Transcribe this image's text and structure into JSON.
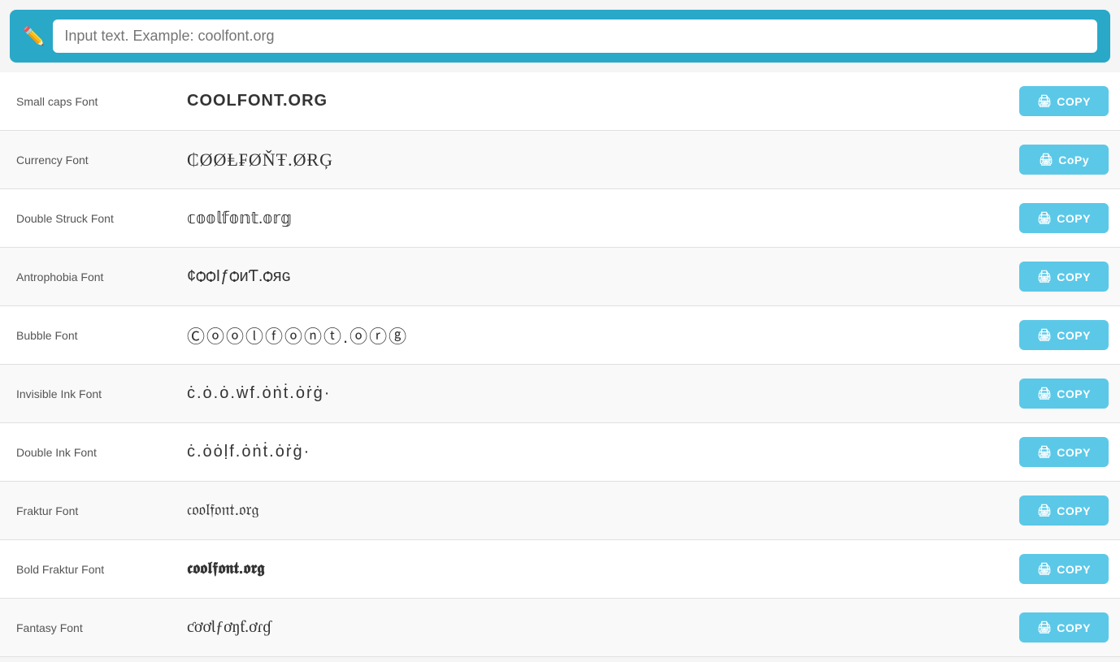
{
  "header": {
    "placeholder": "Input text. Example: coolfont.org",
    "pencil_icon": "✏️"
  },
  "fonts": [
    {
      "label": "Small caps Font",
      "preview": "COOLFONT.ORG",
      "style_class": "small-caps",
      "copy_label": "COPY"
    },
    {
      "label": "Currency Font",
      "preview": "₵ØØⱠ₣ØŇŦ.ØɌĢ",
      "style_class": "currency",
      "copy_label": "CoPy"
    },
    {
      "label": "Double Struck Font",
      "preview": "𝕔𝕠𝕠𝕝𝕗𝕠𝕟𝕥.𝕠𝕣𝕘",
      "style_class": "double-struck",
      "copy_label": "COPY"
    },
    {
      "label": "Antrophobia Font",
      "preview": "¢ѻѻӀƒѻиƬ.ѻяɢ",
      "style_class": "antrophobia",
      "copy_label": "COPY"
    },
    {
      "label": "Bubble Font",
      "preview": "Ⓒⓞⓞⓛⓕⓞⓝⓣ.ⓞⓡⓖ",
      "style_class": "bubble",
      "copy_label": "COPY"
    },
    {
      "label": "Invisible Ink Font",
      "preview": "ċ.ȯ.ȯ.ẇf.ȯṅṫ.ȯṙġ·",
      "style_class": "invisible-ink",
      "copy_label": "COPY"
    },
    {
      "label": "Double Ink Font",
      "preview": "ċ.ȯȯḷf.ȯṅṫ.ȯṙġ·",
      "style_class": "double-ink",
      "copy_label": "COPY"
    },
    {
      "label": "Fraktur Font",
      "preview": "𝔠𝔬𝔬𝔩𝔣𝔬𝔫𝔱.𝔬𝔯𝔤",
      "style_class": "fraktur",
      "copy_label": "COPY"
    },
    {
      "label": "Bold Fraktur Font",
      "preview": "𝖈𝖔𝖔𝖑𝖋𝖔𝖓𝖙.𝖔𝖗𝖌",
      "style_class": "bold-fraktur",
      "copy_label": "COPY"
    },
    {
      "label": "Fantasy Font",
      "preview": "ƈơơƖƒơŋƭ.ơɾɠ",
      "style_class": "fantasy",
      "copy_label": "COPY"
    }
  ],
  "copy_icon": "🖨"
}
